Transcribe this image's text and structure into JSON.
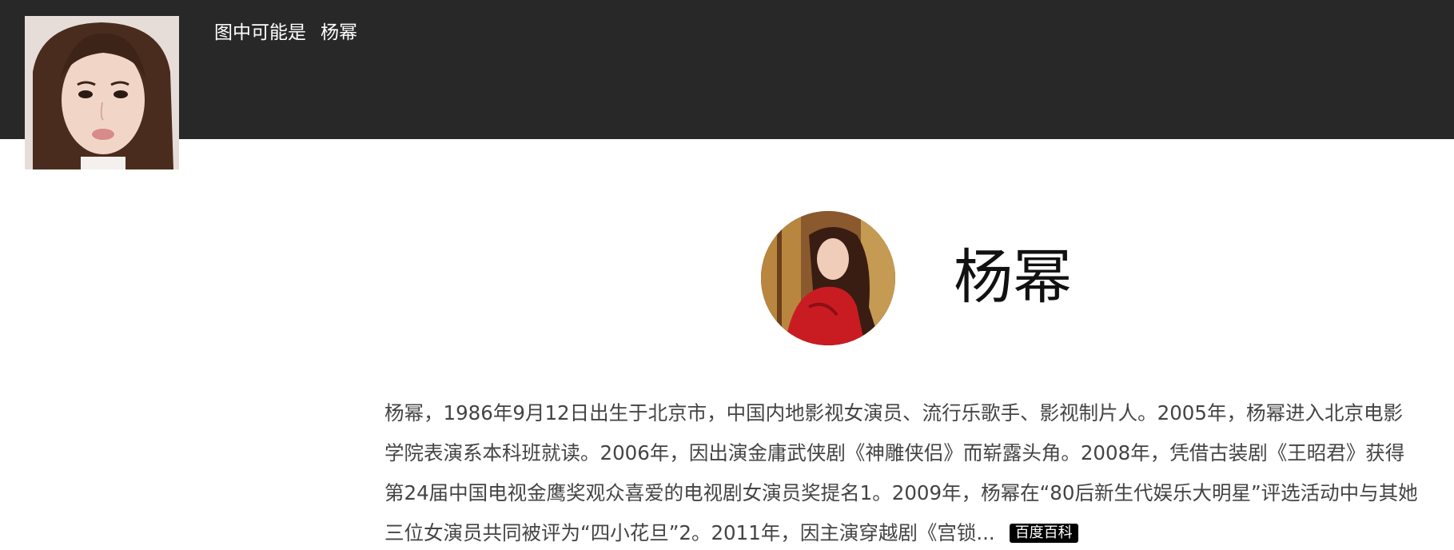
{
  "header": {
    "prefix": "图中可能是",
    "name": "杨幂"
  },
  "entity": {
    "name": "杨幂",
    "bio_lines": [
      "杨幂，1986年9月12日出生于北京市，中国内地影视女演员、流行乐歌手、影视制片人。2005年，杨幂进入北京电影",
      "学院表演系本科班就读。2006年，因出演金庸武侠剧《神雕侠侣》而崭露头角。2008年，凭借古装剧《王昭君》获得",
      "第24届中国电视金鹰奖观众喜爱的电视剧女演员奖提名1。2009年，杨幂在“80后新生代娱乐大明星”评选活动中与其她",
      "三位女演员共同被评为“四小花旦”2。2011年，因主演穿越剧《宫锁..."
    ],
    "source_badge": "百度百科"
  },
  "colors": {
    "top_bar": "#282828",
    "badge_bg": "#000000",
    "text": "#444444"
  }
}
